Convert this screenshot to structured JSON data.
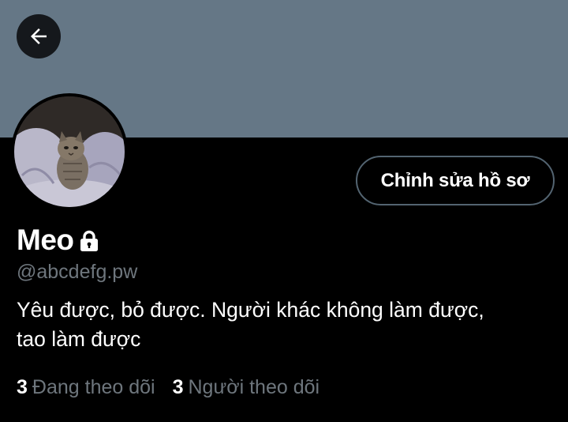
{
  "colors": {
    "banner": "#657786",
    "background": "#000000",
    "text_primary": "#ffffff",
    "text_secondary": "#6e767d",
    "button_border": "#536471"
  },
  "header": {
    "back_icon": "arrow-left-icon"
  },
  "profile": {
    "edit_button_label": "Chỉnh sửa hồ sơ",
    "display_name": "Meo",
    "protected_icon": "lock-icon",
    "handle": "@abcdefg.pw",
    "bio_line_1": "Yêu được, bỏ được. Người khác không làm được,",
    "bio_line_2": "tao làm được"
  },
  "stats": {
    "following_count": "3",
    "following_label": "Đang theo dõi",
    "followers_count": "3",
    "followers_label": "Người theo dõi"
  }
}
